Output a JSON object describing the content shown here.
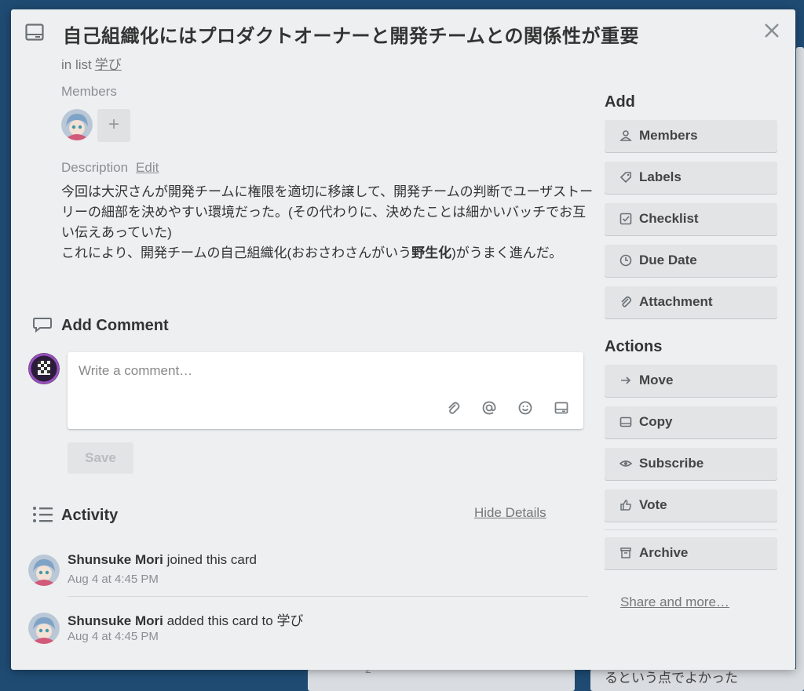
{
  "card": {
    "title": "自己組織化にはプロダクトオーナーと開発チームとの関係性が重要",
    "in_list_prefix": "in list",
    "list_name": "学び"
  },
  "members": {
    "label": "Members",
    "add_symbol": "+"
  },
  "description": {
    "label": "Description",
    "edit_label": "Edit",
    "line1": "今回は大沢さんが開発チームに権限を適切に移譲して、開発チームの判断でユーザストーリーの細部を決めやすい環境だった。(その代わりに、決めたことは細かいバッチでお互い伝えあっていた)",
    "line2_before": "これにより、開発チームの自己組織化(おおさわさんがいう",
    "line2_bold": "野生化",
    "line2_after": ")がうまく進んだ。"
  },
  "comment": {
    "heading": "Add Comment",
    "placeholder": "Write a comment…",
    "save_label": "Save"
  },
  "activity": {
    "heading": "Activity",
    "hide_details": "Hide Details",
    "items": [
      {
        "user": "Shunsuke Mori",
        "action": "joined this card",
        "time": "Aug 4 at 4:45 PM"
      },
      {
        "user": "Shunsuke Mori",
        "action": "added this card to 学び",
        "time": "Aug 4 at 4:45 PM"
      }
    ]
  },
  "sidebar": {
    "add_heading": "Add",
    "add_buttons": [
      {
        "label": "Members",
        "icon": "person-icon"
      },
      {
        "label": "Labels",
        "icon": "tag-icon"
      },
      {
        "label": "Checklist",
        "icon": "checkbox-icon"
      },
      {
        "label": "Due Date",
        "icon": "clock-icon"
      },
      {
        "label": "Attachment",
        "icon": "paperclip-icon"
      }
    ],
    "actions_heading": "Actions",
    "action_buttons": [
      {
        "label": "Move",
        "icon": "arrow-right-icon"
      },
      {
        "label": "Copy",
        "icon": "card-icon"
      },
      {
        "label": "Subscribe",
        "icon": "eye-icon"
      },
      {
        "label": "Vote",
        "icon": "thumbs-up-icon"
      },
      {
        "label": "Archive",
        "icon": "archive-icon"
      }
    ],
    "share_label": "Share and more…"
  },
  "background": {
    "bottom_text": "るという点でよかった",
    "bottom_count": "2"
  }
}
